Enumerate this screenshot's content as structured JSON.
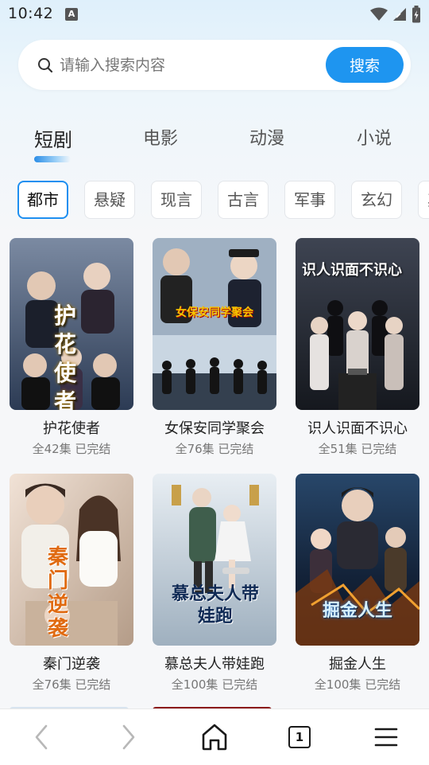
{
  "status_bar": {
    "time": "10:42",
    "notification_glyph": "A"
  },
  "search": {
    "placeholder": "请输入搜索内容",
    "button_label": "搜索"
  },
  "tabs": [
    {
      "label": "短剧",
      "active": true
    },
    {
      "label": "电影",
      "active": false
    },
    {
      "label": "动漫",
      "active": false
    },
    {
      "label": "小说",
      "active": false
    }
  ],
  "chips": [
    {
      "label": "都市",
      "active": true
    },
    {
      "label": "悬疑",
      "active": false
    },
    {
      "label": "现言",
      "active": false
    },
    {
      "label": "古言",
      "active": false
    },
    {
      "label": "军事",
      "active": false
    },
    {
      "label": "玄幻",
      "active": false
    },
    {
      "label": "其他",
      "active": false
    }
  ],
  "dramas": [
    {
      "title": "护花使者",
      "meta": "全42集 已完结",
      "poster_text": "护花使者",
      "poster_colors": [
        "#6f7f98",
        "#2c3b54"
      ]
    },
    {
      "title": "女保安同学聚会",
      "meta": "全76集 已完结",
      "poster_text": "女保安同学聚会",
      "poster_colors": [
        "#aab8c8",
        "#3c4658"
      ]
    },
    {
      "title": "识人识面不识心",
      "meta": "全51集 已完结",
      "poster_text": "识人识面不识心",
      "poster_colors": [
        "#3a3f4d",
        "#1a1d24"
      ]
    },
    {
      "title": "秦门逆袭",
      "meta": "全76集 已完结",
      "poster_text": "秦门逆袭",
      "poster_colors": [
        "#e9d6c6",
        "#b9a28f"
      ]
    },
    {
      "title": "慕总夫人带娃跑",
      "meta": "全100集 已完结",
      "poster_text": "慕总夫人带娃跑",
      "poster_colors": [
        "#dfe7ee",
        "#a7b6c4"
      ]
    },
    {
      "title": "掘金人生",
      "meta": "全100集 已完结",
      "poster_text": "掘金人生",
      "poster_colors": [
        "#1f3550",
        "#0d1828"
      ]
    }
  ],
  "bottom_nav": {
    "tab_count": "1"
  },
  "icons": {
    "search": "search-icon",
    "wifi": "wifi-icon",
    "signal": "signal-icon",
    "battery": "battery-icon",
    "back": "chevron-left-icon",
    "forward": "chevron-right-icon",
    "home": "home-icon",
    "tabs": "tab-count-icon",
    "menu": "menu-icon"
  },
  "colors": {
    "accent": "#1e95f0",
    "chip_border_active": "#1e8ff0"
  }
}
